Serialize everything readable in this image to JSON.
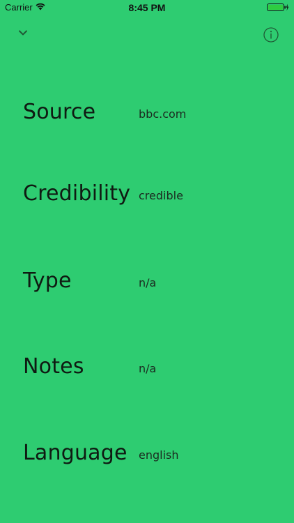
{
  "status_bar": {
    "carrier": "Carrier",
    "time": "8:45 PM"
  },
  "nav": {
    "collapse_icon": "chevron-down-icon",
    "info_icon": "info-icon"
  },
  "colors": {
    "background": "#2ecc71",
    "text": "#111111"
  },
  "details": [
    {
      "label": "Source",
      "value": "bbc.com"
    },
    {
      "label": "Credibility",
      "value": "credible"
    },
    {
      "label": "Type",
      "value": "n/a"
    },
    {
      "label": "Notes",
      "value": "n/a"
    },
    {
      "label": "Language",
      "value": "english"
    }
  ]
}
